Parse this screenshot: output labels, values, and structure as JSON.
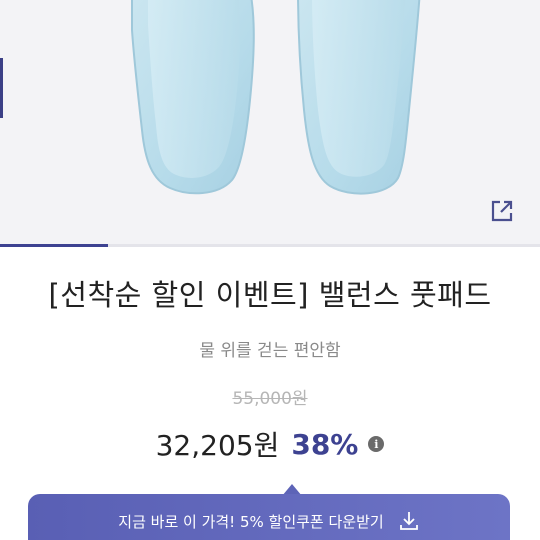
{
  "product": {
    "title": "[선착순 할인 이벤트] 밸런스 풋패드",
    "subtitle": "물 위를 걷는 편안함",
    "original_price": "55,000원",
    "sale_price": "32,205원",
    "discount": "38%",
    "info_icon_glyph": "i"
  },
  "gallery": {
    "progress_fraction": 0.2,
    "share_icon": "external-link-icon"
  },
  "coupon": {
    "label": "지금 바로 이 가격! 5% 할인쿠폰 다운받기",
    "icon": "download-icon"
  },
  "colors": {
    "accent": "#3d4291",
    "coupon_bg": "#6268bb",
    "pad_fill": "#bfe0ec",
    "image_bg": "#f3f3f6"
  }
}
